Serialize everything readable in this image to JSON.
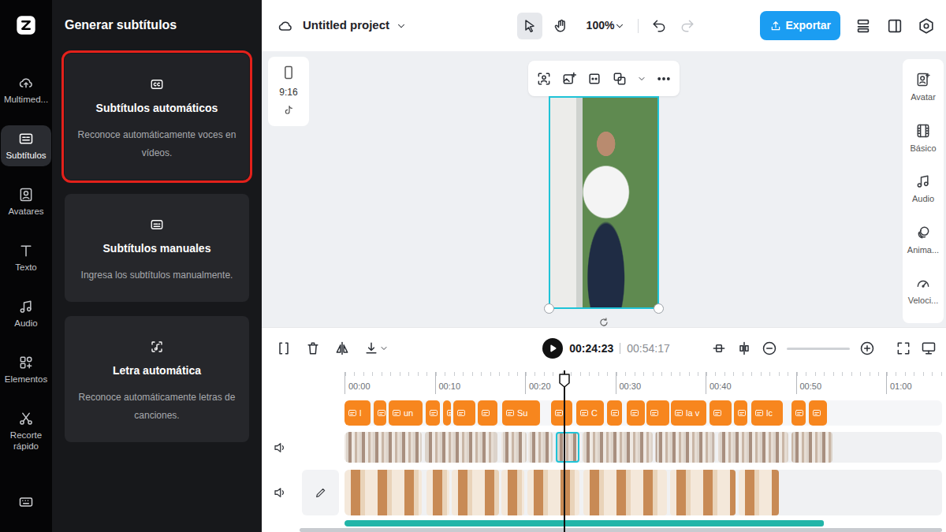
{
  "rail": {
    "items": [
      {
        "label": "Multimed...",
        "selected": false
      },
      {
        "label": "Subtítulos",
        "selected": true
      },
      {
        "label": "Avatares",
        "selected": false
      },
      {
        "label": "Texto",
        "selected": false
      },
      {
        "label": "Audio",
        "selected": false
      },
      {
        "label": "Elementos",
        "selected": false
      },
      {
        "label": "Recorte rápido",
        "selected": false
      }
    ]
  },
  "panel": {
    "title": "Generar subtítulos",
    "options": [
      {
        "title": "Subtítulos automáticos",
        "description": "Reconoce automáticamente voces en vídeos.",
        "highlighted": true
      },
      {
        "title": "Subtítulos manuales",
        "description": "Ingresa los subtítulos manualmente.",
        "highlighted": false
      },
      {
        "title": "Letra automática",
        "description": "Reconoce automáticamente letras de canciones.",
        "highlighted": false
      }
    ]
  },
  "topbar": {
    "project": "Untitled project",
    "tools": [
      {
        "selected": true
      },
      {
        "selected": false
      }
    ],
    "zoom": "100%",
    "undo": {
      "disabled": false
    },
    "redo": {
      "disabled": true
    },
    "export": "Exportar"
  },
  "canvas": {
    "format": {
      "ratio": "9:16"
    },
    "preview": {
      "selected": true
    }
  },
  "right_rail": {
    "items": [
      {
        "label": "Avatar"
      },
      {
        "label": "Básico"
      },
      {
        "label": "Audio"
      },
      {
        "label": "Anima..."
      },
      {
        "label": "Veloci..."
      }
    ]
  },
  "timeline": {
    "playing": false,
    "current": "00:24:23",
    "total": "00:54:17",
    "playhead": 0.4064,
    "zoom": {
      "level": 0
    },
    "ruler": [
      "00:00",
      "00:10",
      "00:20",
      "00:30",
      "00:40",
      "00:50",
      "01:00"
    ],
    "subtitles": [
      {
        "text": "l",
        "start": 0.0,
        "seconds": 2.9
      },
      {
        "text": "",
        "start": 3.2,
        "seconds": 1.4
      },
      {
        "text": "un",
        "start": 4.9,
        "seconds": 3.8
      },
      {
        "text": "",
        "start": 9.0,
        "seconds": 1.6
      },
      {
        "text": "",
        "start": 10.9,
        "seconds": 0.9
      },
      {
        "text": "",
        "start": 12.1,
        "seconds": 2.4
      },
      {
        "text": "",
        "start": 14.8,
        "seconds": 2.2
      },
      {
        "text": "Su",
        "start": 17.5,
        "seconds": 4.2
      },
      {
        "text": "",
        "start": 22.9,
        "seconds": 2.4
      },
      {
        "text": "C",
        "start": 25.7,
        "seconds": 3.1
      },
      {
        "text": "",
        "start": 29.1,
        "seconds": 1.7
      },
      {
        "text": "",
        "start": 31.3,
        "seconds": 2.0
      },
      {
        "text": "",
        "start": 33.5,
        "seconds": 2.5
      },
      {
        "text": "la v",
        "start": 36.2,
        "seconds": 3.9
      },
      {
        "text": "",
        "start": 40.5,
        "seconds": 2.4
      },
      {
        "text": "",
        "start": 43.2,
        "seconds": 1.5
      },
      {
        "text": "lc",
        "start": 45.1,
        "seconds": 3.5
      },
      {
        "text": "",
        "start": 49.6,
        "seconds": 1.5
      },
      {
        "text": "",
        "start": 51.5,
        "seconds": 2.0
      }
    ],
    "video": [
      {
        "start": 0.0,
        "seconds": 8.7,
        "selected": false
      },
      {
        "start": 8.9,
        "seconds": 8.2,
        "selected": false
      },
      {
        "start": 17.4,
        "seconds": 3.0,
        "selected": false
      },
      {
        "start": 20.4,
        "seconds": 2.8,
        "selected": false
      },
      {
        "start": 23.4,
        "seconds": 2.8,
        "selected": true
      },
      {
        "start": 26.4,
        "seconds": 7.9,
        "selected": false
      },
      {
        "start": 34.4,
        "seconds": 6.8,
        "selected": false
      },
      {
        "start": 41.4,
        "seconds": 7.9,
        "selected": false
      },
      {
        "start": 49.5,
        "seconds": 4.7,
        "selected": false
      }
    ],
    "images": [
      {
        "start": 0.0,
        "seconds": 8.7
      },
      {
        "start": 9.1,
        "seconds": 2.7
      },
      {
        "start": 11.9,
        "seconds": 5.4
      },
      {
        "start": 17.4,
        "seconds": 2.7
      },
      {
        "start": 20.3,
        "seconds": 5.9
      },
      {
        "start": 26.5,
        "seconds": 9.4
      },
      {
        "start": 36.1,
        "seconds": 7.4
      },
      {
        "start": 43.7,
        "seconds": 4.6
      }
    ],
    "audio": {
      "start": 0,
      "seconds": 53.1
    }
  }
}
